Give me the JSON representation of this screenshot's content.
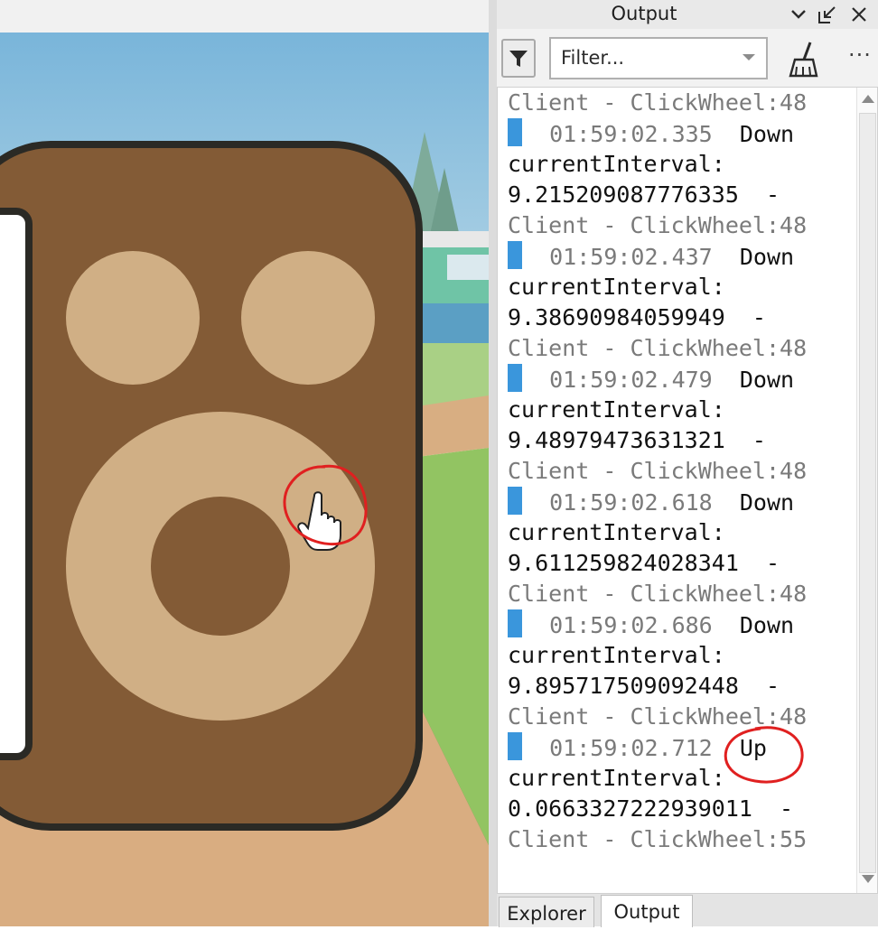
{
  "output_panel": {
    "title": "Output",
    "filter_placeholder": "Filter...",
    "log": [
      {
        "kind": "source",
        "text": "Client - ClickWheel:48"
      },
      {
        "kind": "entry",
        "time": "01:59:02.335",
        "message": "Down"
      },
      {
        "kind": "text",
        "text": "currentInterval:"
      },
      {
        "kind": "text",
        "text": "9.215209087776335  -"
      },
      {
        "kind": "source",
        "text": "Client - ClickWheel:48"
      },
      {
        "kind": "entry",
        "time": "01:59:02.437",
        "message": "Down"
      },
      {
        "kind": "text",
        "text": "currentInterval:"
      },
      {
        "kind": "text",
        "text": "9.38690984059949  -"
      },
      {
        "kind": "source",
        "text": "Client - ClickWheel:48"
      },
      {
        "kind": "entry",
        "time": "01:59:02.479",
        "message": "Down"
      },
      {
        "kind": "text",
        "text": "currentInterval:"
      },
      {
        "kind": "text",
        "text": "9.48979473631321  -"
      },
      {
        "kind": "source",
        "text": "Client - ClickWheel:48"
      },
      {
        "kind": "entry",
        "time": "01:59:02.618",
        "message": "Down"
      },
      {
        "kind": "text",
        "text": "currentInterval:"
      },
      {
        "kind": "text",
        "text": "9.611259824028341  -"
      },
      {
        "kind": "source",
        "text": "Client - ClickWheel:48"
      },
      {
        "kind": "entry",
        "time": "01:59:02.686",
        "message": "Down"
      },
      {
        "kind": "text",
        "text": "currentInterval:"
      },
      {
        "kind": "text",
        "text": "9.895717509092448  -"
      },
      {
        "kind": "source",
        "text": "Client - ClickWheel:48"
      },
      {
        "kind": "entry",
        "time": "01:59:02.712",
        "message": "Up"
      },
      {
        "kind": "text",
        "text": "currentInterval:"
      },
      {
        "kind": "text",
        "text": "0.0663327222939011  -"
      },
      {
        "kind": "source",
        "text": "Client - ClickWheel:55"
      }
    ],
    "tabs": [
      "Explorer",
      "Output"
    ],
    "active_tab": "Output",
    "marker_color": "#3a96dc"
  },
  "icons": {
    "panel": [
      "chevron-down-icon",
      "undock-icon",
      "close-icon",
      "filter-icon",
      "dropdown-arrow-icon",
      "clear-broom-icon",
      "more-options-icon"
    ],
    "viewport": [
      "hand-cursor-icon"
    ]
  },
  "annotations": {
    "color": "#e02020",
    "circled": [
      "hand-cursor-icon",
      "Up"
    ]
  }
}
